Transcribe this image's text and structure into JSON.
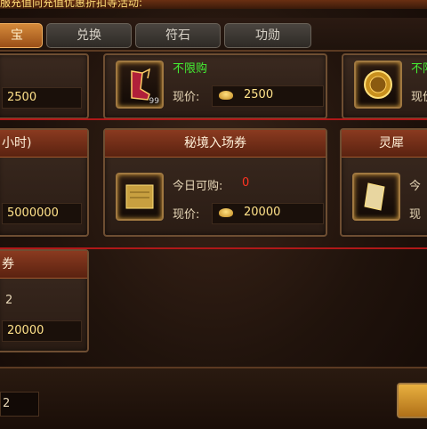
{
  "banner": {
    "text": "服充值向充值优惠折扣等活动:"
  },
  "tabs": [
    {
      "label": "宝"
    },
    {
      "label": "兑换"
    },
    {
      "label": "符石"
    },
    {
      "label": "功勋"
    }
  ],
  "row1": {
    "left": {
      "price": "2500"
    },
    "middle": {
      "limit": "不限购",
      "price_label": "现价:",
      "price": "2500",
      "qty": "99"
    },
    "right": {
      "limit": "不限",
      "price_label": "现价"
    }
  },
  "row2": {
    "left": {
      "title": "小时)",
      "price": "5000000"
    },
    "middle": {
      "title": "秘境入场券",
      "daily_label": "今日可购:",
      "daily_value": "0",
      "price_label": "现价:",
      "price": "20000"
    },
    "right": {
      "title": "灵犀",
      "daily_label": "今",
      "price_label": "现"
    }
  },
  "row3": {
    "left": {
      "title": "券",
      "daily_value": "2",
      "price": "20000"
    }
  },
  "bottom": {
    "value": "2"
  },
  "colors": {
    "limit_text": "#44ee33",
    "zero_text": "#ff3322",
    "price_text": "#ffe28a",
    "active_tab": "#c06a28"
  }
}
